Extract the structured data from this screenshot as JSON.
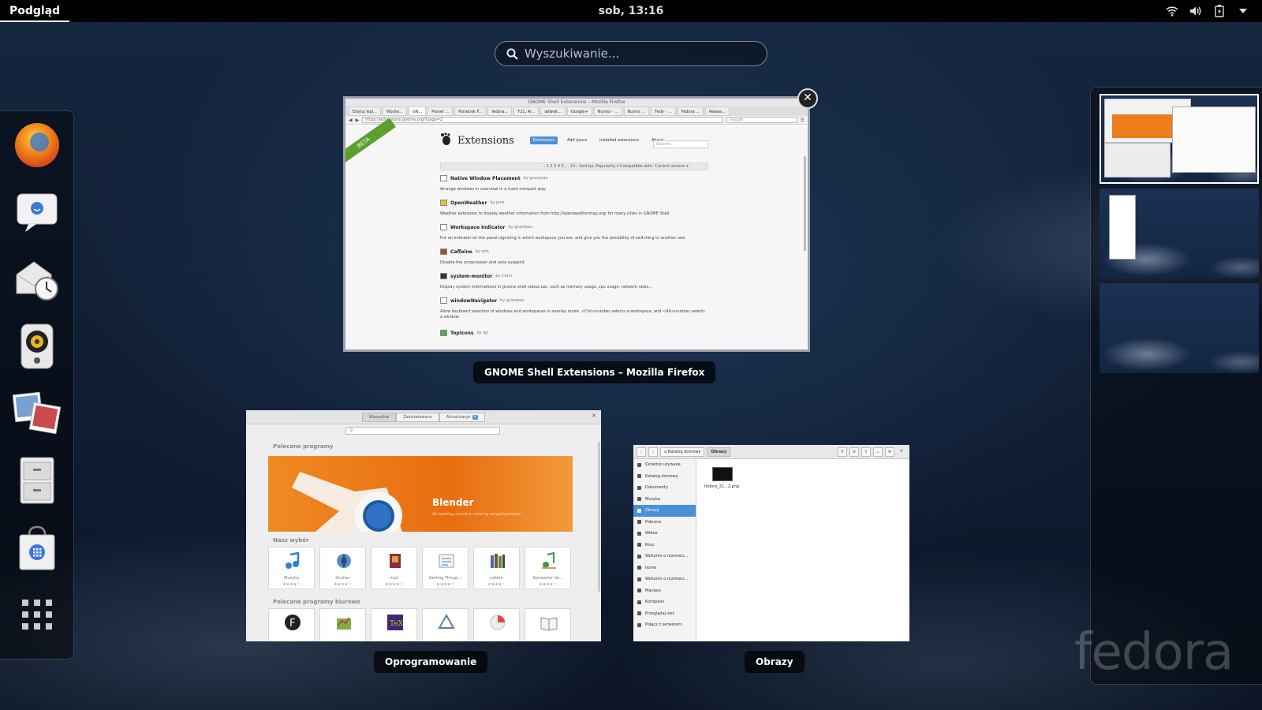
{
  "topbar": {
    "activities_label": "Podgląd",
    "clock": "sob, 13:16",
    "status_icons": [
      "wifi-icon",
      "volume-icon",
      "battery-icon",
      "arrow-down-icon"
    ]
  },
  "search": {
    "placeholder": "Wyszukiwanie..."
  },
  "dash": {
    "apps": [
      "firefox-icon",
      "empathy-chat-icon",
      "evolution-mail-icon",
      "rhythmbox-speaker-icon",
      "shotwell-photos-icon",
      "file-cabinet-icon",
      "software-bag-icon",
      "show-apps-grid-icon"
    ]
  },
  "windows": {
    "firefox": {
      "caption": "GNOME Shell Extensions – Mozilla Firefox",
      "titlebar": "GNOME Shell Extensions – Mozilla Firefox",
      "tabs": [
        "Edytuj wpi...",
        "Wocke...",
        "GN...",
        "Planet ...",
        "Poradnik F...",
        "fedora...",
        "F21, Al...",
        "adwait...",
        "Google+",
        "Numix - ...",
        "Numix ...",
        "Fedy - ...",
        "Fedora ...",
        "Releas..."
      ],
      "url": "https://extensions.gnome.org/?page=2",
      "search_engine": "Google",
      "site": {
        "beta": "BETA",
        "title": "Extensions",
        "nav": [
          "Extensions",
          "Add yours",
          "Installed extensions",
          "About"
        ],
        "search_placeholder": "Search...",
        "pager": "‹ 1 2 3 4 5 ... 14 ›   Sort by: Popularity ▾   Compatible with: Current version ▾",
        "items": [
          {
            "name": "Native Window Placement",
            "by": "by gcampax",
            "desc": "Arrange windows in overview in a more compact way."
          },
          {
            "name": "OpenWeather",
            "by": "by jens",
            "desc": "Weather extension to display weather information from http://openweathermap.org/ for many cities in GNOME Shell"
          },
          {
            "name": "Workspace Indicator",
            "by": "by gcampax",
            "desc": "Put an indicator on the panel signaling in which workspace you are, and give you the possibility of switching to another one."
          },
          {
            "name": "Caffeine",
            "by": "by eon",
            "desc": "Disable the screensaver and auto suspend"
          },
          {
            "name": "system-monitor",
            "by": "by Cerin",
            "desc": "Display system informations in gnome shell status bar, such as memory usage, cpu usage, network rates..."
          },
          {
            "name": "windowNavigator",
            "by": "by gcampax",
            "desc": "Allow keyboard selection of windows and workspaces in overlay mode. <Ctrl>number selects a workspace, and <Alt>number selects a window."
          },
          {
            "name": "TopIcons",
            "by": "by ag",
            "desc": ""
          }
        ]
      }
    },
    "software": {
      "caption": "Oprogramowanie",
      "tabs": [
        "Wszystkie",
        "Zainstalowane",
        "Aktualizacje"
      ],
      "updates_count": "4",
      "section_featured": "Polecane programy",
      "banner_name": "Blender",
      "banner_sub": "3D modelling, animation, rendering and post-production",
      "section_picks": "Nasz wybór",
      "picks": [
        {
          "name": "Muzyka",
          "icon": "music-note-icon",
          "rating": "★★★★☆"
        },
        {
          "name": "Shutter",
          "icon": "shutter-icon",
          "rating": "★★★★☆"
        },
        {
          "name": "mp2",
          "icon": "book-icon",
          "rating": "★★★★☆"
        },
        {
          "name": "Getting Things...",
          "icon": "checklist-icon",
          "rating": "★★★★☆"
        },
        {
          "name": "calibre",
          "icon": "books-icon",
          "rating": "★★★★☆"
        },
        {
          "name": "Konwerter dź...",
          "icon": "sound-converter-icon",
          "rating": "★★★★☆"
        }
      ],
      "section_office": "Polecane programy biurowe",
      "office": [
        "font-manager-icon",
        "gnucash-icon",
        "texmaker-icon",
        "inkscape-icon",
        "calligra-icon",
        "reader-icon"
      ]
    },
    "files": {
      "caption": "Obrazy",
      "breadcrumbs": [
        "Katalog domowy",
        "Obrazy"
      ],
      "sidebar": [
        "Ostatnio używane",
        "Katalog domowy",
        "Dokumenty",
        "Muzyka",
        "Obrazy",
        "Pobrane",
        "Wideo",
        "Kosz",
        "Wolumin o rozmiarz...",
        "home",
        "Wolumin o rozmiarz...",
        "Manjaro",
        "Komputer",
        "Przeglądaj sieć",
        "Połącz z serwerem"
      ],
      "active_index": 4,
      "file_name": "fedora_21...2.png"
    }
  },
  "watermark": "fedora"
}
